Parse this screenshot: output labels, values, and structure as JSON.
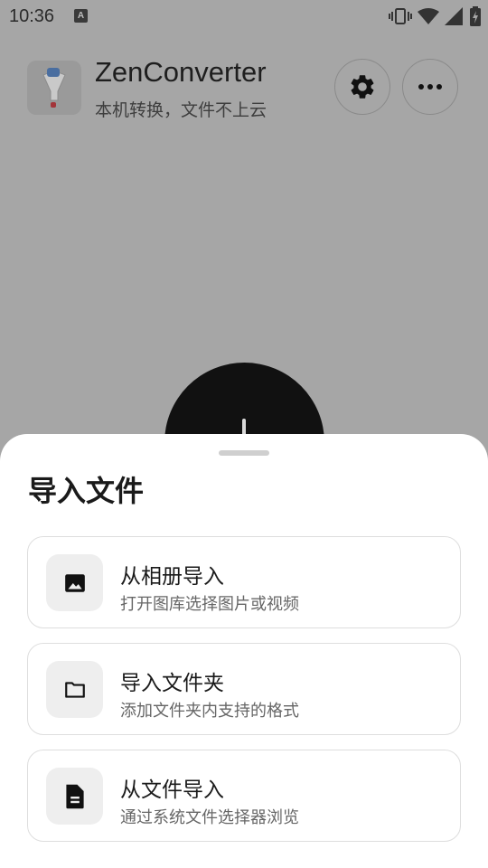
{
  "status_bar": {
    "time": "10:36",
    "notification_icon": "A",
    "icons": [
      "vibrate-icon",
      "wifi-icon",
      "signal-icon",
      "battery-icon"
    ]
  },
  "header": {
    "app_name": "ZenConverter",
    "tagline": "本机转换，文件不上云",
    "icon": "funnel-icon",
    "settings_icon": "gear-icon",
    "more_icon": "more-icon"
  },
  "sheet": {
    "title": "导入文件",
    "options": [
      {
        "title": "从相册导入",
        "description": "打开图库选择图片或视频",
        "icon": "image-icon"
      },
      {
        "title": "导入文件夹",
        "description": "添加文件夹内支持的格式",
        "icon": "folder-icon"
      },
      {
        "title": "从文件导入",
        "description": "通过系统文件选择器浏览",
        "icon": "document-icon"
      }
    ]
  }
}
